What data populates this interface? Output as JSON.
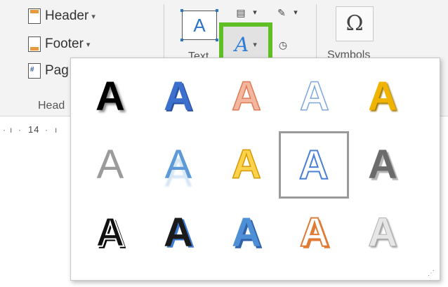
{
  "ribbon": {
    "header_label": "Header",
    "footer_label": "Footer",
    "page_number_label": "Pag",
    "header_footer_group": "Head",
    "text_group": "Text",
    "symbols_group": "Symbols",
    "textbox_glyph": "A",
    "wordart_glyph": "A",
    "omega_glyph": "Ω",
    "dropdown_caret": "▾"
  },
  "ruler": {
    "value": "14"
  },
  "wordart_gallery": {
    "selected_index": 9,
    "styles": [
      {
        "glyph": "A",
        "style": "black-shadow"
      },
      {
        "glyph": "A",
        "style": "blue-fill"
      },
      {
        "glyph": "A",
        "style": "orange-outline-light"
      },
      {
        "glyph": "A",
        "style": "white-blue-outline"
      },
      {
        "glyph": "A",
        "style": "gold-shadow"
      },
      {
        "glyph": "A",
        "style": "gray-gradient"
      },
      {
        "glyph": "A",
        "style": "blue-reflection"
      },
      {
        "glyph": "A",
        "style": "gold-outline"
      },
      {
        "glyph": "A",
        "style": "blue-double-outline"
      },
      {
        "glyph": "A",
        "style": "dark-gray-bevel"
      },
      {
        "glyph": "A",
        "style": "black-white-outline"
      },
      {
        "glyph": "A",
        "style": "black-blue-shadow"
      },
      {
        "glyph": "A",
        "style": "blue-bevel"
      },
      {
        "glyph": "A",
        "style": "orange-inline"
      },
      {
        "glyph": "A",
        "style": "silver-bevel"
      }
    ]
  },
  "colors": {
    "highlight_border": "#5fbf24",
    "accent_blue": "#2e7dd7",
    "selected_border": "#9a9a9a"
  }
}
